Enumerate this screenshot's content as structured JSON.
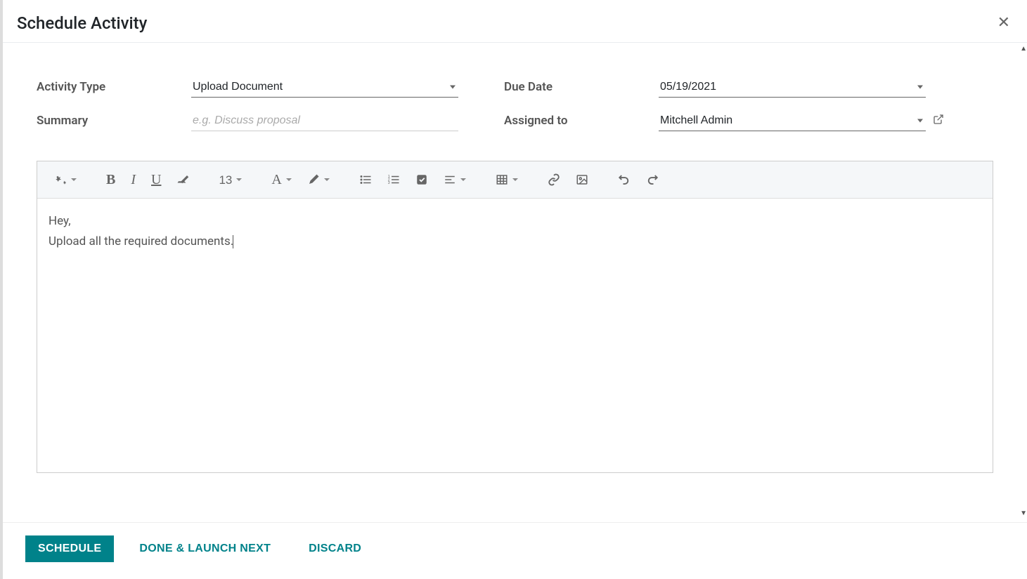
{
  "modal": {
    "title": "Schedule Activity"
  },
  "form": {
    "activity_type": {
      "label": "Activity Type",
      "value": "Upload Document"
    },
    "due_date": {
      "label": "Due Date",
      "value": "05/19/2021"
    },
    "summary": {
      "label": "Summary",
      "placeholder": "e.g. Discuss proposal",
      "value": ""
    },
    "assigned_to": {
      "label": "Assigned to",
      "value": "Mitchell Admin"
    }
  },
  "editor": {
    "font_size": "13",
    "content_line1": "Hey,",
    "content_line2": "Upload all the required documents."
  },
  "toolbar_icons": {
    "magic": "magic-wand-icon",
    "bold": "bold-icon",
    "italic": "italic-icon",
    "underline": "underline-icon",
    "clear": "clear-format-icon",
    "font_color": "font-color-icon",
    "highlight": "highlight-icon",
    "ul": "unordered-list-icon",
    "ol": "ordered-list-icon",
    "checkbox": "checkbox-icon",
    "align": "align-icon",
    "table": "table-icon",
    "link": "link-icon",
    "image": "image-icon",
    "undo": "undo-icon",
    "redo": "redo-icon"
  },
  "footer": {
    "schedule": "SCHEDULE",
    "done_next": "DONE & LAUNCH NEXT",
    "discard": "DISCARD"
  }
}
